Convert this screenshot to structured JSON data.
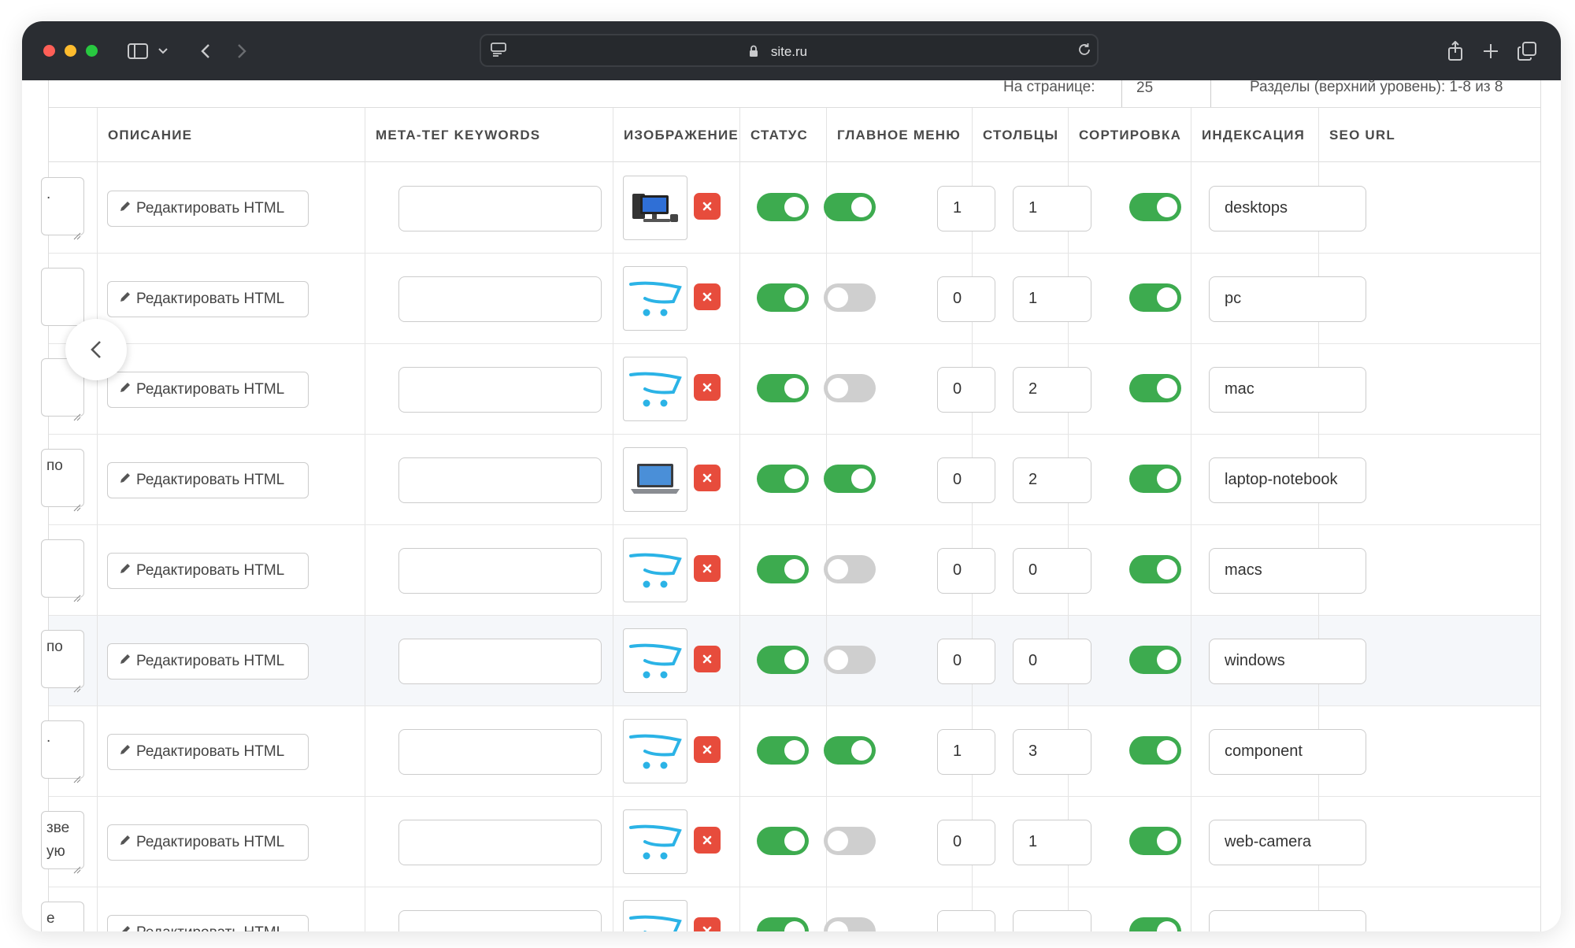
{
  "browser": {
    "url": "site.ru"
  },
  "top_controls": {
    "per_page_label": "На странице:",
    "per_page_value": "25",
    "sections_label": "Разделы (верхний уровень): 1-8 из 8"
  },
  "table": {
    "headers": {
      "description": "ОПИСАНИЕ",
      "meta_keywords": "МЕТА-ТЕГ KEYWORDS",
      "image": "ИЗОБРАЖЕНИЕ",
      "status": "СТАТУС",
      "main_menu": "ГЛАВНОЕ МЕНЮ",
      "columns": "СТОЛБЦЫ",
      "sort": "СОРТИРОВКА",
      "indexing": "ИНДЕКСАЦИЯ",
      "seo_url": "SEO URL"
    },
    "edit_html_label": "Редактировать HTML",
    "rows": [
      {
        "stub": ".",
        "image": "desktop",
        "status": true,
        "main_menu": true,
        "columns": "1",
        "sort": "1",
        "indexing": true,
        "seo": "desktops"
      },
      {
        "stub": "",
        "image": "cart",
        "status": true,
        "main_menu": false,
        "columns": "0",
        "sort": "1",
        "indexing": true,
        "seo": "pc"
      },
      {
        "stub": "",
        "image": "cart",
        "status": true,
        "main_menu": false,
        "columns": "0",
        "sort": "2",
        "indexing": true,
        "seo": "mac"
      },
      {
        "stub": "по",
        "image": "laptop",
        "status": true,
        "main_menu": true,
        "columns": "0",
        "sort": "2",
        "indexing": true,
        "seo": "laptop-notebook"
      },
      {
        "stub": "",
        "image": "cart",
        "status": true,
        "main_menu": false,
        "columns": "0",
        "sort": "0",
        "indexing": true,
        "seo": "macs"
      },
      {
        "stub": "по",
        "image": "cart",
        "status": true,
        "main_menu": false,
        "columns": "0",
        "sort": "0",
        "indexing": true,
        "seo": "windows"
      },
      {
        "stub": ".",
        "image": "cart",
        "status": true,
        "main_menu": true,
        "columns": "1",
        "sort": "3",
        "indexing": true,
        "seo": "component"
      },
      {
        "stub": "зве\nую",
        "image": "cart",
        "status": true,
        "main_menu": false,
        "columns": "0",
        "sort": "1",
        "indexing": true,
        "seo": "web-camera"
      },
      {
        "stub": "е",
        "image": "cart",
        "status": true,
        "main_menu": false,
        "columns": "",
        "sort": "",
        "indexing": true,
        "seo": ""
      }
    ]
  },
  "colors": {
    "toggle_on": "#3dab4f",
    "toggle_off": "#cfcfcf",
    "delete": "#e74c3c",
    "titlebar": "#2a2d32"
  }
}
